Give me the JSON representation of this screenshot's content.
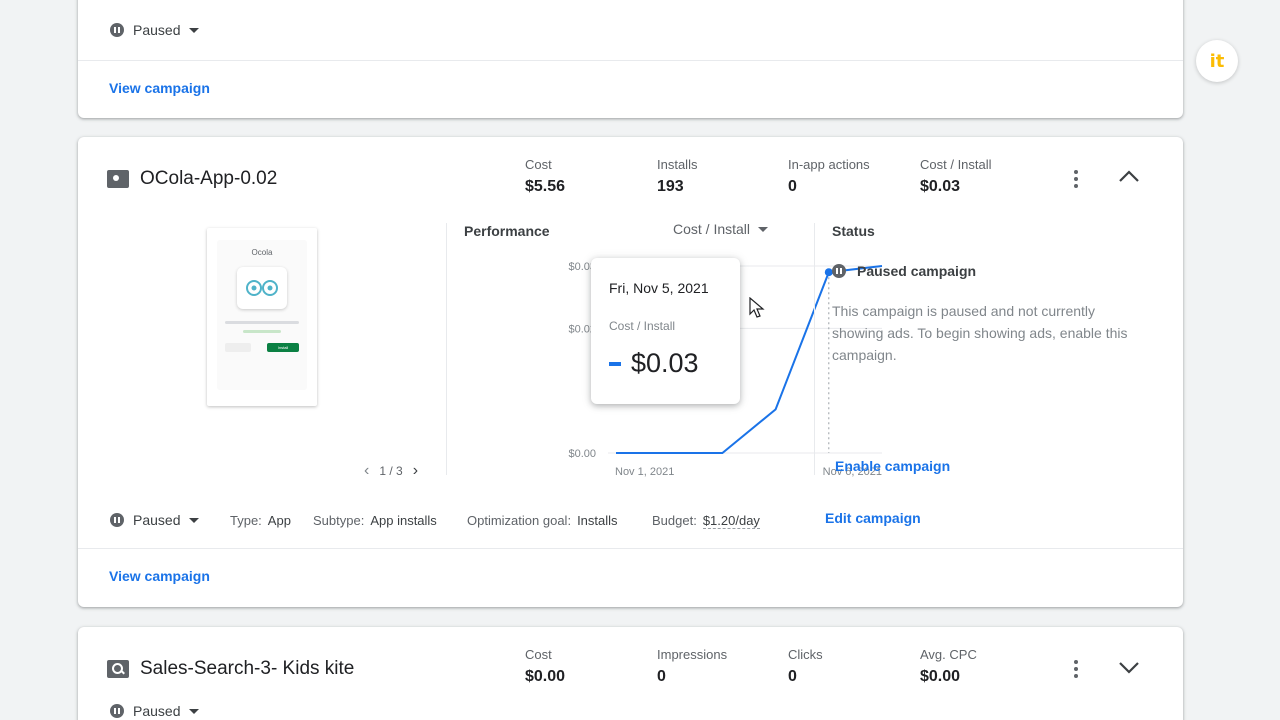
{
  "card_top": {
    "status": "Paused",
    "view_link": "View campaign"
  },
  "campaign_app": {
    "name": "OCola-App-0.02",
    "metrics": [
      {
        "label": "Cost",
        "value": "$5.56"
      },
      {
        "label": "Installs",
        "value": "193"
      },
      {
        "label": "In-app actions",
        "value": "0"
      },
      {
        "label": "Cost / Install",
        "value": "$0.03"
      }
    ],
    "preview": {
      "app_name": "Ocola",
      "pager": "1 / 3",
      "button_label": "Install"
    },
    "performance": {
      "title": "Performance",
      "metric_selector": "Cost / Install",
      "tooltip": {
        "date": "Fri, Nov 5, 2021",
        "metric": "Cost / Install",
        "value": "$0.03"
      },
      "cursor_date": "Nov 5, 2021"
    },
    "status_panel": {
      "title": "Status",
      "state": "Paused campaign",
      "description": "This campaign is paused and not currently showing ads. To begin showing ads, enable this campaign.",
      "enable_link": "Enable campaign"
    },
    "footer": {
      "status": "Paused",
      "type_label": "Type:",
      "type_value": "App",
      "subtype_label": "Subtype:",
      "subtype_value": "App installs",
      "goal_label": "Optimization goal:",
      "goal_value": "Installs",
      "budget_label": "Budget:",
      "budget_value": "$1.20/day",
      "edit_link": "Edit campaign"
    },
    "view_link": "View campaign"
  },
  "chart_data": {
    "type": "line",
    "x": [
      "2021-11-01",
      "2021-11-02",
      "2021-11-03",
      "2021-11-04",
      "2021-11-05",
      "2021-11-06"
    ],
    "series": [
      {
        "values": [
          0.0,
          0.0,
          0.0,
          0.007,
          0.029,
          0.03
        ]
      }
    ],
    "y_ticks": [
      "$0.00",
      "$0.02",
      "$0.03"
    ],
    "x_tick_labels": [
      "Nov 1, 2021",
      "Nov 6, 2021"
    ],
    "ylim": [
      0,
      0.03
    ],
    "grid": true,
    "color": "#1a73e8"
  },
  "campaign_search": {
    "name": "Sales-Search-3- Kids kite",
    "metrics": [
      {
        "label": "Cost",
        "value": "$0.00"
      },
      {
        "label": "Impressions",
        "value": "0"
      },
      {
        "label": "Clicks",
        "value": "0"
      },
      {
        "label": "Avg. CPC",
        "value": "$0.00"
      }
    ],
    "status": "Paused"
  },
  "badge": {
    "text": "it"
  },
  "colors": {
    "accent": "#1a73e8",
    "background": "#f1f3f4",
    "paused": "#5f6368"
  }
}
